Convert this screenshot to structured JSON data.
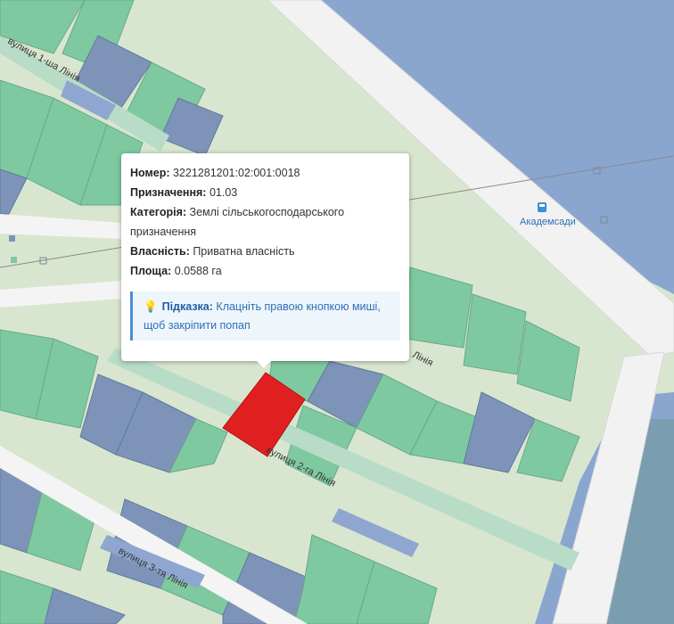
{
  "map": {
    "streets": {
      "first_line": "вулиця 1-ша Лінія",
      "second_line": "вулиця 2-га Лінія",
      "third_line": "вулиця 3-тя Лінія",
      "fragment_line": "Лінія"
    },
    "station": "Академсади"
  },
  "popup": {
    "number_label": "Номер:",
    "number_value": "3221281201:02:001:0018",
    "purpose_label": "Призначення:",
    "purpose_value": "01.03",
    "category_label": "Категорія:",
    "category_value": "Землі сільськогосподарського призначення",
    "ownership_label": "Власність:",
    "ownership_value": "Приватна власність",
    "area_label": "Площа:",
    "area_value": "0.0588 га",
    "hint_label": "Підказка:",
    "hint_text": "Клацніть правою кнопкою миші, щоб закріпити попап"
  },
  "colors": {
    "green_parcel": "#7fc9a0",
    "blue_parcel": "#7d94b8",
    "water": "#8aa6cf",
    "selected_parcel": "#e02020",
    "background": "#d9e6cf"
  }
}
